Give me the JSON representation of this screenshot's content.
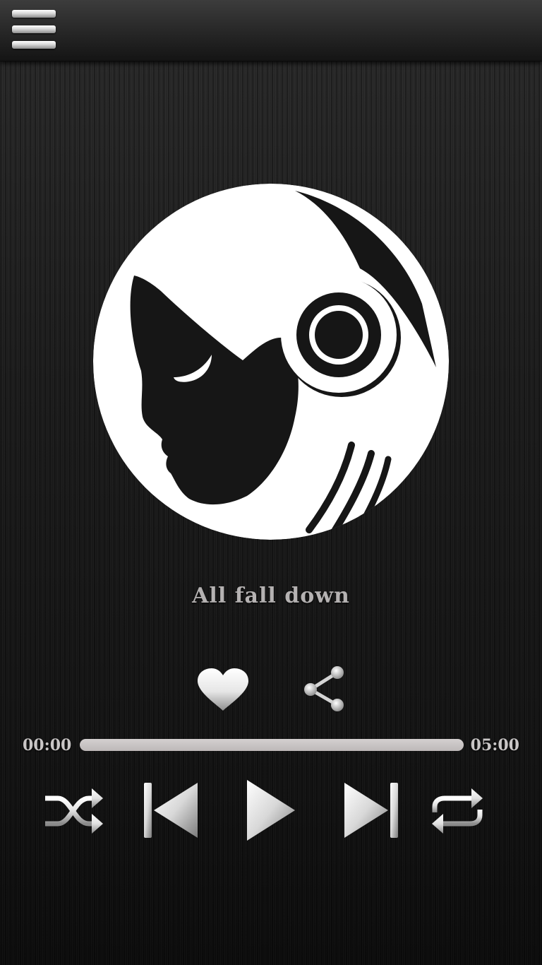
{
  "header": {
    "menu_icon": "hamburger-menu-icon"
  },
  "album_art": {
    "icon": "headphones-woman-silhouette-icon"
  },
  "track": {
    "title": "All fall down"
  },
  "actions": {
    "favorite_icon": "heart-icon",
    "share_icon": "share-icon"
  },
  "playback": {
    "elapsed": "00:00",
    "total": "05:00",
    "progress_fraction": 1.0
  },
  "controls": {
    "shuffle_icon": "shuffle-icon",
    "previous_icon": "skip-previous-icon",
    "play_icon": "play-icon",
    "next_icon": "skip-next-icon",
    "repeat_icon": "repeat-icon"
  },
  "colors": {
    "background": "#1a1a1a",
    "text": "#b5b2b2",
    "progress": "#c9c5c5"
  }
}
